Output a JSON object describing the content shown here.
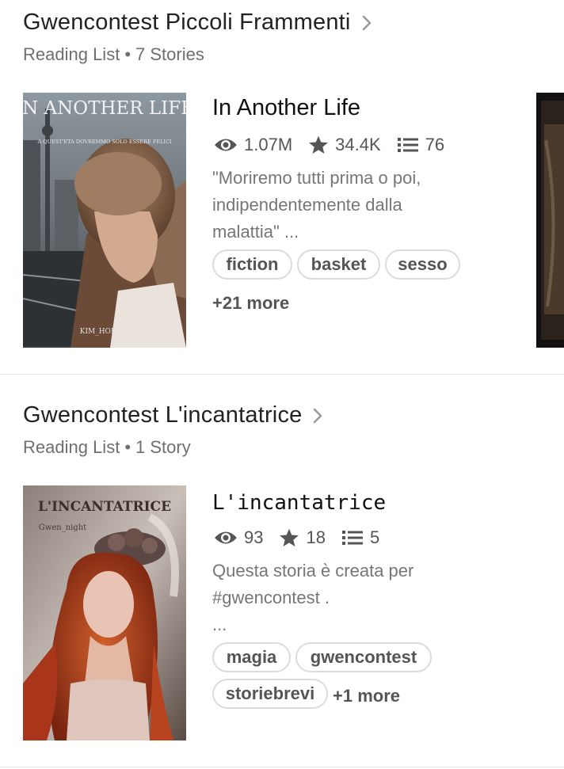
{
  "lists": [
    {
      "title": "Gwencontest Piccoli Frammenti",
      "subtitle_type": "Reading List",
      "subtitle_count": "7 Stories",
      "story": {
        "title": "In Another Life",
        "cover_title": "IN ANOTHER LIFE",
        "cover_tagline": "A QUEST'ETÀ DOVREMMO SOLO ESSERE FELICI",
        "cover_author": "KIM_HOLLY",
        "reads": "1.07M",
        "votes": "34.4K",
        "parts": "76",
        "description_lines": [
          "\"Moriremo tutti prima o poi,",
          "indipendentemente dalla",
          "malattia\" ..."
        ],
        "tags": [
          "fiction",
          "basket",
          "sesso"
        ],
        "more": "+21 more"
      }
    },
    {
      "title": "Gwencontest L'incantatrice",
      "subtitle_type": "Reading List",
      "subtitle_count": "1 Story",
      "story": {
        "title": "L'incantatrice",
        "cover_title": "L'INCANTATRICE",
        "cover_author": "Gwen_night",
        "reads": "93",
        "votes": "18",
        "parts": "5",
        "description_lines": [
          "Questa storia è creata per",
          "#gwencontest .",
          "..."
        ],
        "tags": [
          "magia",
          "gwencontest",
          "storiebrevi"
        ],
        "more": "+1 more"
      }
    }
  ],
  "colors": {
    "background": "#ffffff",
    "title_text": "#222222",
    "subtle_text": "#6f6f6f",
    "tag_border": "#dcdcdc",
    "divider": "#e2e2e2"
  },
  "icons": {
    "chevron": "chevron-right-icon",
    "reads": "eye-icon",
    "votes": "star-icon",
    "parts": "list-icon"
  }
}
